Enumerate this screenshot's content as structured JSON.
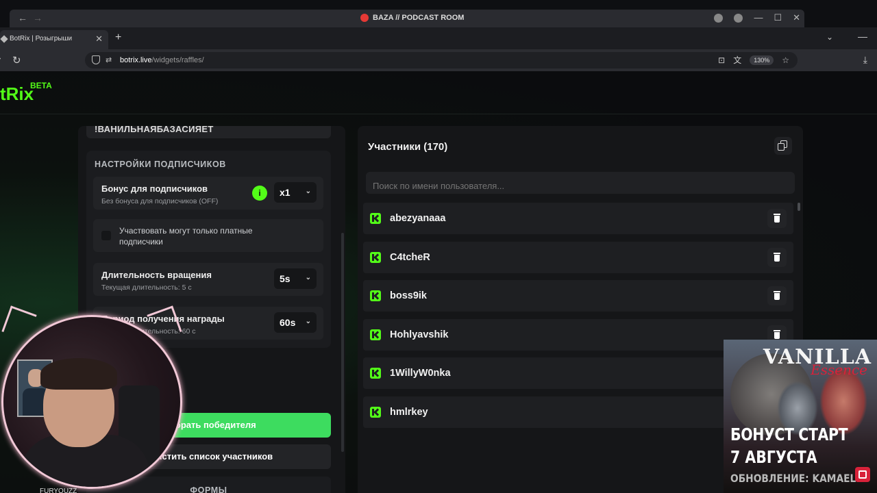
{
  "window": {
    "title": "BAZA // PODCAST ROOM"
  },
  "browser": {
    "tab_title": "BotRix | Розыгрыши",
    "new_tab": "+",
    "url_host": "botrix.live",
    "url_path": "/widgets/raffles/",
    "zoom": "130%"
  },
  "app": {
    "logo": "tRix",
    "logo_badge": "BETA"
  },
  "left_panel": {
    "command_value": "!ВАНИЛЬНАЯБАЗАСИЯЕТ",
    "section_title": "НАСТРОЙКИ ПОДПИСЧИКОВ",
    "sub_bonus": {
      "label": "Бонус для подписчиков",
      "description": "Без бонуса для подписчиков (OFF)",
      "value": "x1",
      "info": "i"
    },
    "paid_only": {
      "label": "Участвовать могут только платные подписчики",
      "checked": false
    },
    "spin_duration": {
      "label": "Длительность вращения",
      "description": "Текущая длительность: 5 с",
      "value": "5s"
    },
    "reward_period": {
      "label": "Период получения награды",
      "description": "Текущая длительность: 60 с",
      "value": "60s"
    },
    "pick_winner_button": "Выбрать победителя",
    "clear_list_button": "Очистить список участников",
    "forms_section": "ФОРМЫ"
  },
  "right_panel": {
    "title": "Участники (170)",
    "search_placeholder": "Поиск по имени пользователя...",
    "participants": [
      "abezyanaaa",
      "C4tcheR",
      "boss9ik",
      "Hohlyavshik",
      "1WillyW0nka",
      "hmlrkey"
    ],
    "platform_icon": "kick-icon"
  },
  "overlay": {
    "webcam_label": "FURYQUZZ",
    "ad": {
      "brand": "VANILLA",
      "brand_script": "Essence",
      "headline_1": "БОНУСТ СТАРТ",
      "headline_2": "7 АВГУСТА",
      "headline_3": "ОБНОВЛЕНИЕ: KAMAEL"
    }
  },
  "colors": {
    "accent": "#53fc18",
    "button_green": "#3ddc5f",
    "panel": "#151618",
    "ad_red": "#d8223a"
  }
}
